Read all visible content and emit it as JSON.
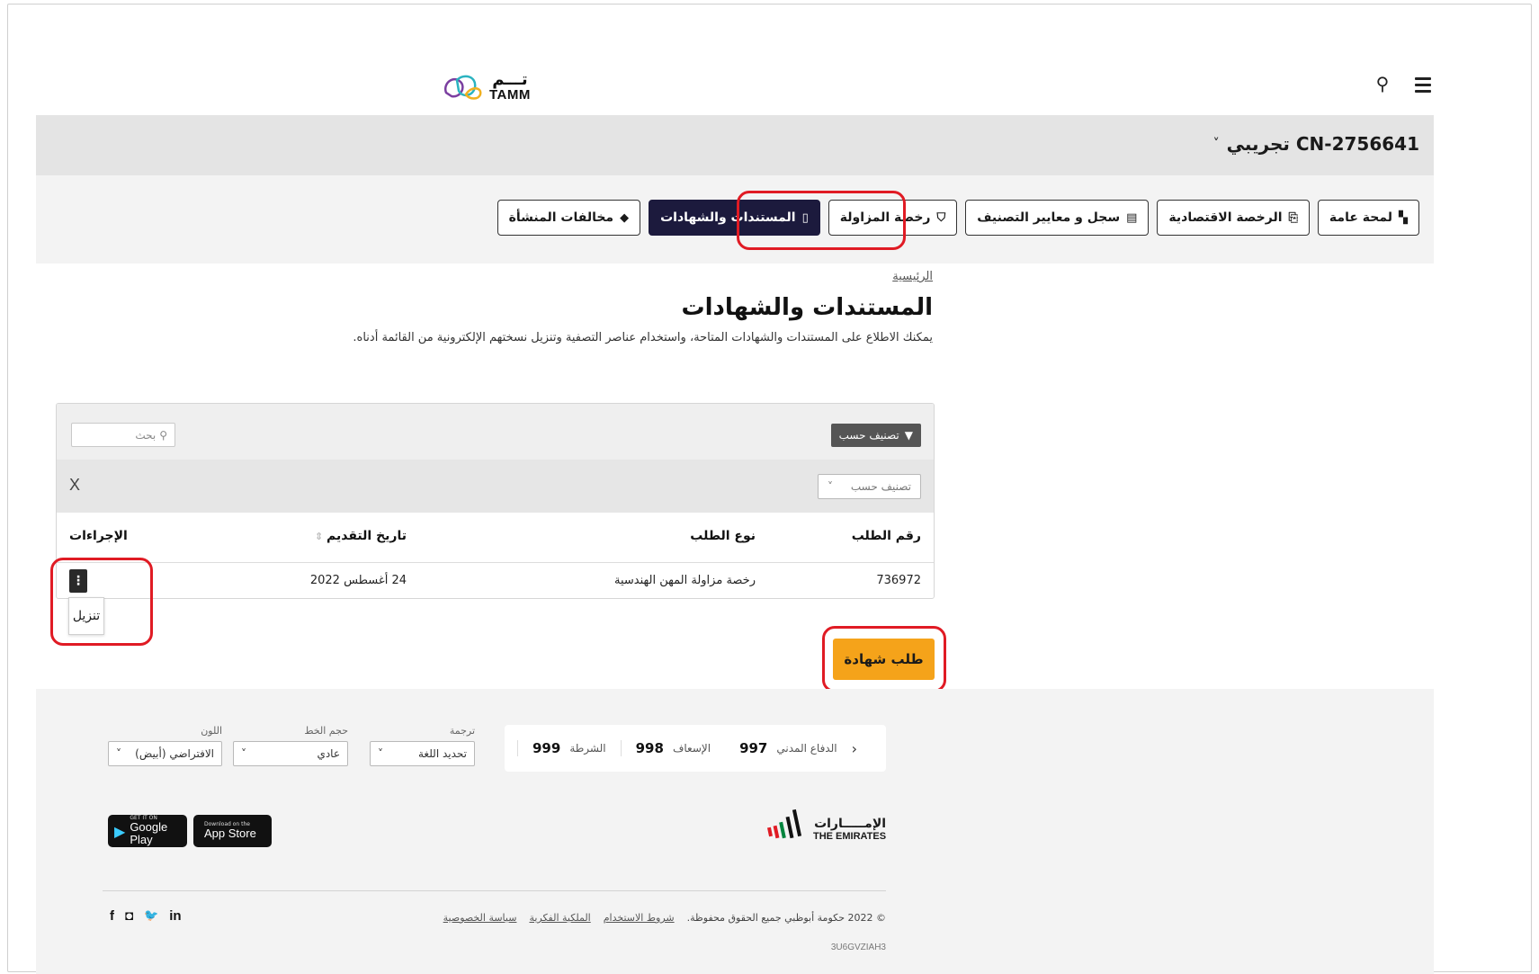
{
  "header": {
    "logo_ar": "تـــم",
    "logo_en": "TAMM",
    "search_icon": "search-icon",
    "menu_icon": "hamburger-menu-icon"
  },
  "account": {
    "name": "CN-2756641 تجريبي",
    "chevron": "˅"
  },
  "tabs": [
    {
      "label": "لمحة عامة",
      "icon": "▚"
    },
    {
      "label": "الرخصة الاقتصادية",
      "icon": "⎘"
    },
    {
      "label": "سجل و معايير التصنيف",
      "icon": "▤"
    },
    {
      "label": "رخصة المزاولة",
      "icon": "⛉"
    },
    {
      "label": "المستندات والشهادات",
      "icon": "▯"
    },
    {
      "label": "مخالفات المنشأة",
      "icon": "◆"
    }
  ],
  "active_tab_index": 4,
  "content": {
    "breadcrumb": "الرئيسية",
    "title": "المستندات والشهادات",
    "description": "يمكنك الاطلاع على المستندات والشهادات المتاحة، واستخدام عناصر التصفية وتنزيل نسختهم الإلكترونية من القائمة أدناه."
  },
  "table": {
    "filter_button": "تصنيف حسب",
    "search_placeholder": "بحث",
    "sort_select": "تصنيف حسب",
    "clear": "X",
    "columns": [
      "رقم الطلب",
      "نوع الطلب",
      "تاريخ التقديم",
      "الإجراءات"
    ],
    "rows": [
      {
        "number": "736972",
        "type": "رخصة مزاولة المهن الهندسية",
        "date": "24 أغسطس 2022",
        "actions": "⋮"
      }
    ],
    "download_label": "تنزيل"
  },
  "request_button": "طلب شهادة",
  "footer": {
    "emergency": [
      {
        "label": "الشرطة",
        "number": "999"
      },
      {
        "label": "الإسعاف",
        "number": "998"
      },
      {
        "label": "الدفاع المدني",
        "number": "997"
      }
    ],
    "emergency_arrow": "‹",
    "translate": {
      "label": "ترجمة",
      "value": "تحديد اللغة"
    },
    "font_size": {
      "label": "حجم الخط",
      "value": "عادي"
    },
    "color": {
      "label": "اللون",
      "value": "الافتراضي (أبيض)"
    },
    "select_chevron": "˅",
    "app_store": {
      "small": "Download on the",
      "big": "App Store"
    },
    "google_play": {
      "small": "GET IT ON",
      "big": "Google Play"
    },
    "emirates_ar": "الإمـــــارات",
    "emirates_en": "THE EMIRATES",
    "links": [
      "سياسة الخصوصية",
      "الملكية الفكرية",
      "شروط الاستخدام"
    ],
    "copyright": "© 2022 حكومة أبوظبي جميع الحقوق محفوظة.",
    "social": [
      "f",
      "◘",
      "🐦",
      "in"
    ],
    "build_code": "3U6GVZIAH3"
  },
  "colors": {
    "active_tab": "#1c1a3d",
    "request_button": "#f5a31a",
    "highlight": "#e01b24"
  }
}
